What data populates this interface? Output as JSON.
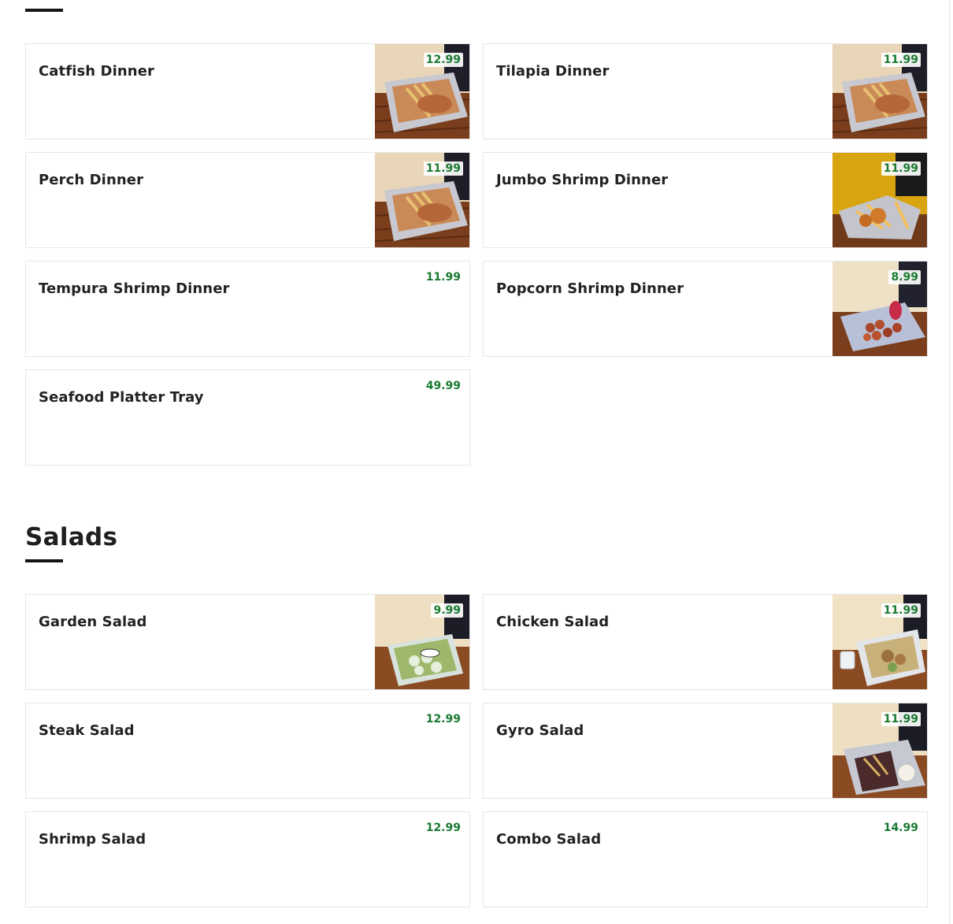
{
  "colors": {
    "price": "#1a7a32",
    "heading": "#1f1f1f"
  },
  "sections": [
    {
      "title": "",
      "items": [
        {
          "name": "Catfish Dinner",
          "price": "12.99",
          "image": "fish-dinner-photo"
        },
        {
          "name": "Tilapia Dinner",
          "price": "11.99",
          "image": "fish-dinner-photo"
        },
        {
          "name": "Perch Dinner",
          "price": "11.99",
          "image": "fish-dinner-photo"
        },
        {
          "name": "Jumbo Shrimp Dinner",
          "price": "11.99",
          "image": "shrimp-dinner-photo"
        },
        {
          "name": "Tempura Shrimp Dinner",
          "price": "11.99",
          "image": ""
        },
        {
          "name": "Popcorn Shrimp Dinner",
          "price": "8.99",
          "image": "popcorn-shrimp-photo"
        },
        {
          "name": "Seafood Platter Tray",
          "price": "49.99",
          "image": ""
        }
      ]
    },
    {
      "title": "Salads",
      "items": [
        {
          "name": "Garden Salad",
          "price": "9.99",
          "image": "garden-salad-photo"
        },
        {
          "name": "Chicken Salad",
          "price": "11.99",
          "image": "chicken-salad-photo"
        },
        {
          "name": "Steak Salad",
          "price": "12.99",
          "image": ""
        },
        {
          "name": "Gyro Salad",
          "price": "11.99",
          "image": "gyro-salad-photo"
        },
        {
          "name": "Shrimp Salad",
          "price": "12.99",
          "image": ""
        },
        {
          "name": "Combo Salad",
          "price": "14.99",
          "image": ""
        }
      ]
    }
  ]
}
